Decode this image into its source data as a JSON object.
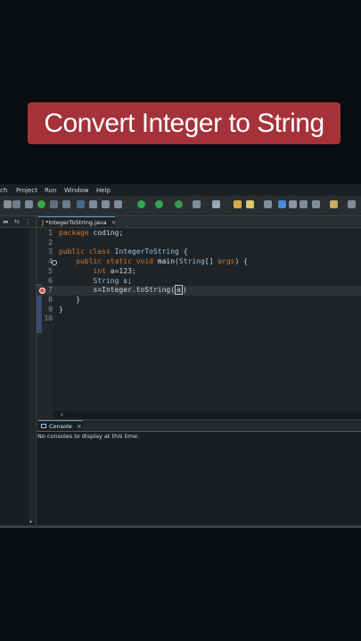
{
  "banner": {
    "title": "Convert Integer  to String"
  },
  "menu": [
    "ch",
    "Project",
    "Run",
    "Window",
    "Help"
  ],
  "editor": {
    "tab_label": "*IntegerToString.java",
    "lines": [
      {
        "no": "1",
        "segments": [
          [
            "kw",
            "package "
          ],
          [
            "plain",
            "coding;"
          ]
        ]
      },
      {
        "no": "2",
        "segments": []
      },
      {
        "no": "3",
        "segments": [
          [
            "kw",
            "public class "
          ],
          [
            "cls",
            "IntegerToString"
          ],
          [
            "plain",
            " {"
          ]
        ]
      },
      {
        "no": "4",
        "segments": [
          [
            "plain",
            "    "
          ],
          [
            "kw",
            "public static void "
          ],
          [
            "fn",
            "main"
          ],
          [
            "plain",
            "("
          ],
          [
            "cls",
            "String"
          ],
          [
            "plain",
            "[] "
          ],
          [
            "kw",
            "args"
          ],
          [
            "plain",
            ") {"
          ]
        ]
      },
      {
        "no": "5",
        "segments": [
          [
            "plain",
            "        "
          ],
          [
            "kw",
            "int "
          ],
          [
            "plain",
            "a=123;"
          ]
        ]
      },
      {
        "no": "6",
        "segments": [
          [
            "plain",
            "        "
          ],
          [
            "cls",
            "String"
          ],
          [
            "plain",
            " s;"
          ]
        ]
      },
      {
        "no": "7",
        "segments": [
          [
            "plain",
            "        s=Integer.toString("
          ],
          [
            "caret",
            "a"
          ],
          [
            "plain",
            ")"
          ]
        ]
      },
      {
        "no": "8",
        "segments": [
          [
            "plain",
            "    }"
          ]
        ]
      },
      {
        "no": "9",
        "segments": [
          [
            "plain",
            "}"
          ]
        ]
      },
      {
        "no": "10",
        "segments": []
      }
    ]
  },
  "console": {
    "tab_label": "Console",
    "message": "No consoles to display at this time."
  },
  "colors": {
    "banner_bg": "#a5323a",
    "background": "#0a0d0f",
    "keyword": "#cc7832",
    "type": "#8fc1e3"
  }
}
